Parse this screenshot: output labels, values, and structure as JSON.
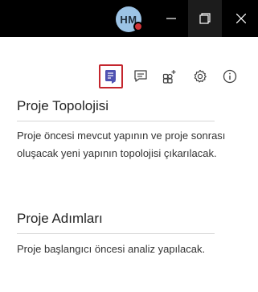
{
  "titlebar": {
    "avatar_initials": "HM",
    "presence_color": "#d13438",
    "window_controls": [
      "minimize-icon",
      "restore-icon",
      "close-icon"
    ]
  },
  "toolbar": {
    "buttons": [
      {
        "icon": "notes-icon",
        "selected": true
      },
      {
        "icon": "chat-icon",
        "selected": false
      },
      {
        "icon": "add-apps-icon",
        "selected": false
      },
      {
        "icon": "gear-icon",
        "selected": false
      },
      {
        "icon": "info-icon",
        "selected": false
      }
    ],
    "accent_color": "#4f52b2",
    "selected_border_color": "#c4262e"
  },
  "sections": [
    {
      "title": "Proje Topolojisi",
      "body": "Proje öncesi mevcut yapının ve proje sonrası oluşacak yeni yapının topolojisi çıkarılacak."
    },
    {
      "title": "Proje Adımları",
      "body": "Proje başlangıcı öncesi analiz yapılacak."
    }
  ]
}
